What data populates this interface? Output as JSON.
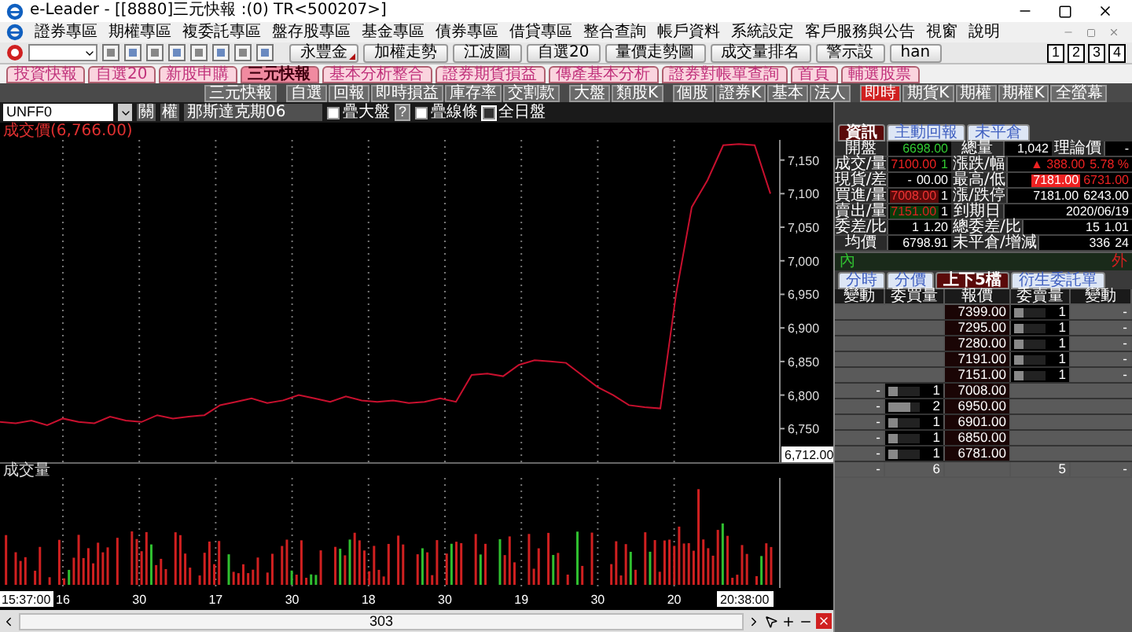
{
  "window": {
    "title": "e-Leader - [[8880]三元快報 :(0) TR<500207>]"
  },
  "menu": [
    "證券專區",
    "期權專區",
    "複委託專區",
    "盤存股專區",
    "基金專區",
    "債券專區",
    "借貸專區",
    "整合查詢",
    "帳戶資料",
    "系統設定",
    "客戶服務與公告",
    "視窗",
    "說明"
  ],
  "toolbar": {
    "buttons": [
      {
        "label": "永豐金",
        "dropdown": true
      },
      {
        "label": "加權走勢",
        "dropdown": false
      },
      {
        "label": "江波圖",
        "dropdown": false
      },
      {
        "label": "自選20",
        "dropdown": false
      },
      {
        "label": "量價走勢圖",
        "dropdown": false
      },
      {
        "label": "成交量排名",
        "dropdown": false
      },
      {
        "label": "警示設",
        "dropdown": false
      },
      {
        "label": "han",
        "dropdown": false
      }
    ],
    "screens": [
      "1",
      "2",
      "3",
      "4"
    ]
  },
  "tabs": [
    {
      "label": "投資快報",
      "selected": false
    },
    {
      "label": "自選20",
      "selected": false
    },
    {
      "label": "新股申購",
      "selected": false
    },
    {
      "label": "三元快報",
      "selected": true
    },
    {
      "label": "基本分析整合",
      "selected": false
    },
    {
      "label": "證券期貨損益",
      "selected": false
    },
    {
      "label": "傳產基本分析",
      "selected": false
    },
    {
      "label": "證券對帳單查詢",
      "selected": false
    },
    {
      "label": "首頁",
      "selected": false
    },
    {
      "label": "輔選股票",
      "selected": false
    }
  ],
  "subtoolbar": [
    [
      {
        "label": "三元快報",
        "selected": false
      }
    ],
    [
      {
        "label": "自選",
        "selected": false
      },
      {
        "label": "回報",
        "selected": false
      },
      {
        "label": "即時損益",
        "selected": false
      },
      {
        "label": "庫存率",
        "selected": false
      },
      {
        "label": "交割款",
        "selected": false
      }
    ],
    [
      {
        "label": "大盤",
        "selected": false
      },
      {
        "label": "類股K",
        "selected": false
      }
    ],
    [
      {
        "label": "個股",
        "selected": false
      },
      {
        "label": "證券K",
        "selected": false
      },
      {
        "label": "基本",
        "selected": false
      },
      {
        "label": "法人",
        "selected": false
      }
    ],
    [
      {
        "label": "即時",
        "selected": true
      },
      {
        "label": "期貨K",
        "selected": false
      },
      {
        "label": "期權",
        "selected": false
      },
      {
        "label": "期權K",
        "selected": false
      },
      {
        "label": "全螢幕",
        "selected": false
      }
    ]
  ],
  "chart": {
    "symbol": "UNFF0",
    "buttons": [
      "關",
      "權"
    ],
    "name": "那斯達克期06",
    "help": "?",
    "checkboxes": [
      {
        "label": "疊大盤",
        "checked": false
      },
      {
        "label": "疊線條",
        "checked": false
      },
      {
        "label": "全日盤",
        "checked": true
      }
    ],
    "price_value": "(6,766.00)",
    "price_marker": "6,712.00",
    "volume_label": "成交量",
    "time_start": "15:37:00",
    "time_end": "20:38:00",
    "time_labels": [
      "16",
      "30",
      "17",
      "30",
      "18",
      "30",
      "19",
      "30",
      "20"
    ],
    "scroll_value": "303",
    "chart_data": {
      "type": "line",
      "grid": true,
      "ylim": [
        6700,
        7180
      ],
      "yticks": [
        {
          "value": 7150,
          "label": "7,150"
        },
        {
          "value": 7100,
          "label": "7,100"
        },
        {
          "value": 7050,
          "label": "7,050"
        },
        {
          "value": 7000,
          "label": "7,000"
        },
        {
          "value": 6950,
          "label": "6,950"
        },
        {
          "value": 6900,
          "label": "6,900"
        },
        {
          "value": 6850,
          "label": "6,850"
        },
        {
          "value": 6800,
          "label": "6,800"
        },
        {
          "value": 6750,
          "label": "6,750"
        }
      ],
      "series": [
        {
          "name": "成交價",
          "color": "#c8102e",
          "values": [
            6760,
            6758,
            6762,
            6755,
            6765,
            6760,
            6758,
            6768,
            6762,
            6760,
            6770,
            6765,
            6768,
            6770,
            6785,
            6790,
            6795,
            6788,
            6792,
            6800,
            6795,
            6790,
            6798,
            6792,
            6790,
            6792,
            6788,
            6790,
            6795,
            6790,
            6830,
            6832,
            6828,
            6845,
            6852,
            6850,
            6848,
            6830,
            6812,
            6800,
            6785,
            6782,
            6780,
            6950,
            7080,
            7120,
            7172,
            7174,
            7172,
            7100
          ]
        }
      ]
    }
  },
  "info": {
    "tabs": [
      {
        "label": "資訊",
        "selected": true
      },
      {
        "label": "主動回報",
        "selected": false
      },
      {
        "label": "未平倉",
        "selected": false
      }
    ],
    "rows": [
      {
        "left": {
          "label": "開盤",
          "values": [
            {
              "text": "6698.00",
              "kind": "down"
            }
          ]
        },
        "right": {
          "label": "總量",
          "values": [
            {
              "text": "1,042",
              "kind": "flat"
            }
          ]
        },
        "extra": {
          "label": "理論價",
          "values": [
            {
              "text": "-",
              "kind": "flat"
            }
          ]
        }
      },
      {
        "left": {
          "label": "成交/量",
          "values": [
            {
              "text": "7100.00",
              "kind": "up"
            },
            {
              "text": "1",
              "kind": "down"
            }
          ]
        },
        "right": {
          "label": "漲跌/幅",
          "values": [
            {
              "text": "▲ 388.00",
              "kind": "up"
            },
            {
              "text": "5.78 %",
              "kind": "up"
            }
          ]
        }
      },
      {
        "left": {
          "label": "現貨/差",
          "values": [
            {
              "text": "-",
              "kind": "flat"
            },
            {
              "text": "00.00",
              "kind": "flat"
            }
          ]
        },
        "right": {
          "label": "最高/低",
          "values": [
            {
              "text": "7181.00",
              "kind": "limit"
            },
            {
              "text": "6731.00",
              "kind": "up"
            }
          ]
        }
      },
      {
        "left": {
          "label": "買進/量",
          "values": [
            {
              "text": "7008.00",
              "kind": "bid"
            },
            {
              "text": "1",
              "kind": "flat"
            }
          ]
        },
        "right": {
          "label": "漲/跌停",
          "values": [
            {
              "text": "7181.00",
              "kind": "flat"
            },
            {
              "text": "6243.00",
              "kind": "flat"
            }
          ]
        }
      },
      {
        "left": {
          "label": "賣出/量",
          "values": [
            {
              "text": "7151.00",
              "kind": "ask"
            },
            {
              "text": "1",
              "kind": "flat"
            }
          ]
        },
        "right": {
          "label": "到期日",
          "values": [
            {
              "text": "2020/06/19",
              "kind": "flat"
            }
          ]
        }
      },
      {
        "left": {
          "label": "委差/比",
          "values": [
            {
              "text": "1",
              "kind": "flat"
            },
            {
              "text": "1.20",
              "kind": "flat"
            }
          ]
        },
        "right": {
          "label": "總委差/比",
          "values": [
            {
              "text": "15",
              "kind": "flat"
            },
            {
              "text": "1.01",
              "kind": "flat"
            }
          ]
        }
      },
      {
        "left": {
          "label": "均價",
          "values": [
            {
              "text": "6798.91",
              "kind": "flat"
            }
          ]
        },
        "right": {
          "label": "未平倉/增減",
          "values": [
            {
              "text": "336",
              "kind": "flat"
            },
            {
              "text": "24",
              "kind": "flat"
            }
          ]
        }
      }
    ],
    "inner": "內",
    "outer": "外"
  },
  "order_book": {
    "tabs": [
      {
        "label": "分時",
        "selected": false
      },
      {
        "label": "分價",
        "selected": false
      },
      {
        "label": "上下5檔",
        "selected": true
      },
      {
        "label": "衍生委託單",
        "selected": false
      }
    ],
    "columns": [
      "變動",
      "委買量",
      "報價",
      "委賣量",
      "變動"
    ],
    "asks": [
      {
        "price": "7399.00",
        "qty": "1",
        "change": "-",
        "level": 0.3
      },
      {
        "price": "7295.00",
        "qty": "1",
        "change": "-",
        "level": 0.3
      },
      {
        "price": "7280.00",
        "qty": "1",
        "change": "-",
        "level": 0.3
      },
      {
        "price": "7191.00",
        "qty": "1",
        "change": "-",
        "level": 0.3
      },
      {
        "price": "7151.00",
        "qty": "1",
        "change": "-",
        "level": 0.3
      }
    ],
    "bids": [
      {
        "change": "-",
        "qty": "1",
        "price": "7008.00",
        "level": 0.3
      },
      {
        "change": "-",
        "qty": "2",
        "price": "6950.00",
        "level": 0.7
      },
      {
        "change": "-",
        "qty": "1",
        "price": "6901.00",
        "level": 0.3
      },
      {
        "change": "-",
        "qty": "1",
        "price": "6850.00",
        "level": 0.3
      },
      {
        "change": "-",
        "qty": "1",
        "price": "6781.00",
        "level": 0.3
      }
    ],
    "totals": {
      "bid_change": "-",
      "bid_qty": "6",
      "ask_qty": "5",
      "ask_change": "-"
    }
  }
}
